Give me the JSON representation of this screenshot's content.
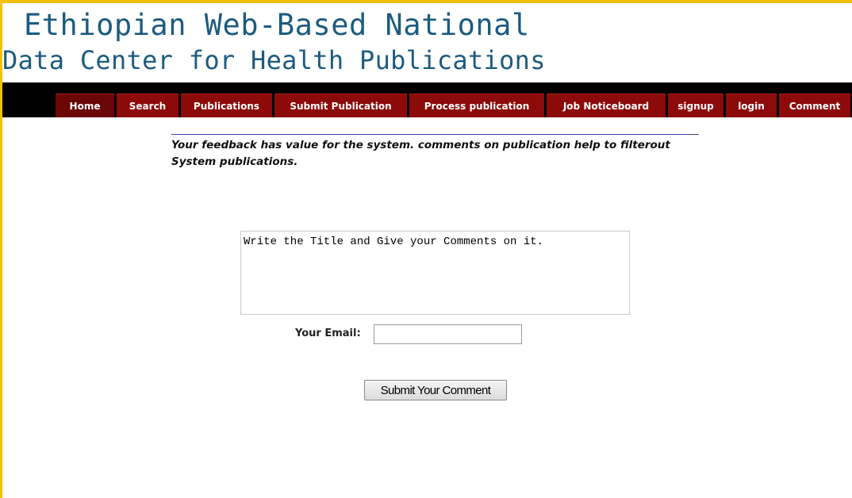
{
  "header": {
    "title_line1": "Ethiopian Web-Based National",
    "title_line2": "Data Center for Health Publications",
    "title_color": "#1c5b80"
  },
  "nav": {
    "bar_color": "#000000",
    "tab_color": "#8d0a0a",
    "active_tab": "Home",
    "items": [
      {
        "label": "Home"
      },
      {
        "label": "Search"
      },
      {
        "label": "Publications"
      },
      {
        "label": "Submit Publication"
      },
      {
        "label": "Process publication"
      },
      {
        "label": "Job Noticeboard"
      },
      {
        "label": "signup"
      },
      {
        "label": "login"
      },
      {
        "label": "Comment"
      }
    ]
  },
  "main": {
    "feedback_text": "Your feedback has value for the system. comments on publication help to filterout System publications.",
    "comment_value": "Write the Title and Give your Comments on it.",
    "email_label": "Your Email:",
    "email_value": "",
    "submit_label": "Submit Your Comment"
  },
  "frame": {
    "border_color": "#f2c200"
  }
}
